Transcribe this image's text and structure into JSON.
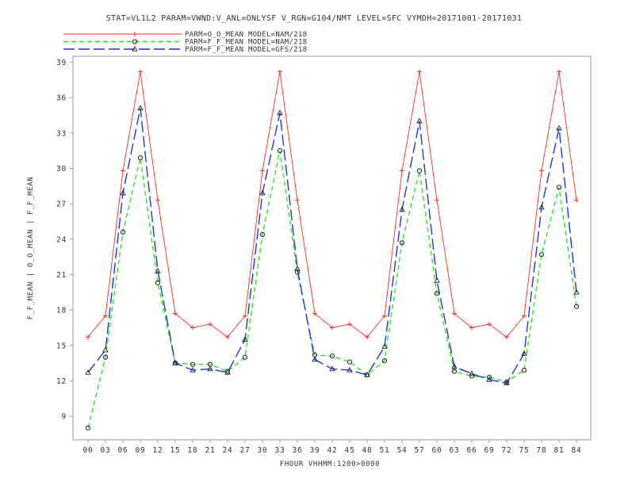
{
  "chart_data": {
    "type": "line",
    "title": "STAT=VL1L2 PARAM=VWND:V_ANL=ONLYSF V_RGN=G104/NMT LEVEL=SFC VYMDH=20171001-20171031",
    "xlabel": "FHOUR VHHMM:1200>0000",
    "ylabel": "F_F_MEAN | O_O_MEAN | F_F_MEAN",
    "ylim": [
      7,
      39.5
    ],
    "yticks": [
      9,
      12,
      15,
      18,
      21,
      24,
      27,
      30,
      33,
      36,
      39
    ],
    "grid": false,
    "legend_position": "top-left",
    "categories": [
      "00",
      "03",
      "06",
      "09",
      "12",
      "15",
      "18",
      "21",
      "24",
      "27",
      "30",
      "33",
      "36",
      "39",
      "42",
      "45",
      "48",
      "51",
      "54",
      "57",
      "60",
      "63",
      "66",
      "69",
      "72",
      "75",
      "78",
      "81",
      "84"
    ],
    "series": [
      {
        "name": "PARM=O_O_MEAN MODEL=NAM/218",
        "color": "#e8332b",
        "marker": "plus",
        "dash": "solid",
        "values": [
          15.7,
          17.5,
          29.8,
          38.2,
          27.3,
          17.7,
          16.5,
          16.8,
          15.7,
          17.5,
          29.8,
          38.2,
          27.3,
          17.7,
          16.5,
          16.8,
          15.7,
          17.5,
          29.8,
          38.2,
          27.3,
          17.7,
          16.5,
          16.8,
          15.7,
          17.5,
          29.8,
          38.2,
          27.3
        ]
      },
      {
        "name": "PARM=F_F_MEAN MODEL=NAM/218",
        "color": "#28e628",
        "marker": "circle",
        "dash": "dashed",
        "values": [
          8.0,
          14.0,
          24.6,
          30.9,
          20.3,
          13.5,
          13.4,
          13.4,
          12.8,
          14.0,
          24.4,
          31.5,
          21.2,
          14.2,
          14.1,
          13.6,
          12.5,
          13.7,
          23.7,
          29.8,
          19.4,
          12.8,
          12.4,
          12.3,
          11.9,
          12.9,
          22.7,
          28.4,
          18.3
        ]
      },
      {
        "name": "PARM=F_F_MEAN MODEL=GFS/218",
        "color": "#2436c8",
        "marker": "triangle",
        "dash": "longdash",
        "values": [
          12.7,
          14.6,
          27.9,
          35.1,
          21.3,
          13.5,
          12.9,
          13.0,
          12.7,
          15.5,
          27.9,
          34.7,
          21.5,
          13.8,
          13.0,
          12.9,
          12.5,
          14.9,
          26.5,
          34.0,
          20.5,
          13.2,
          12.6,
          12.1,
          11.8,
          14.3,
          26.7,
          33.4,
          19.5
        ]
      }
    ]
  }
}
